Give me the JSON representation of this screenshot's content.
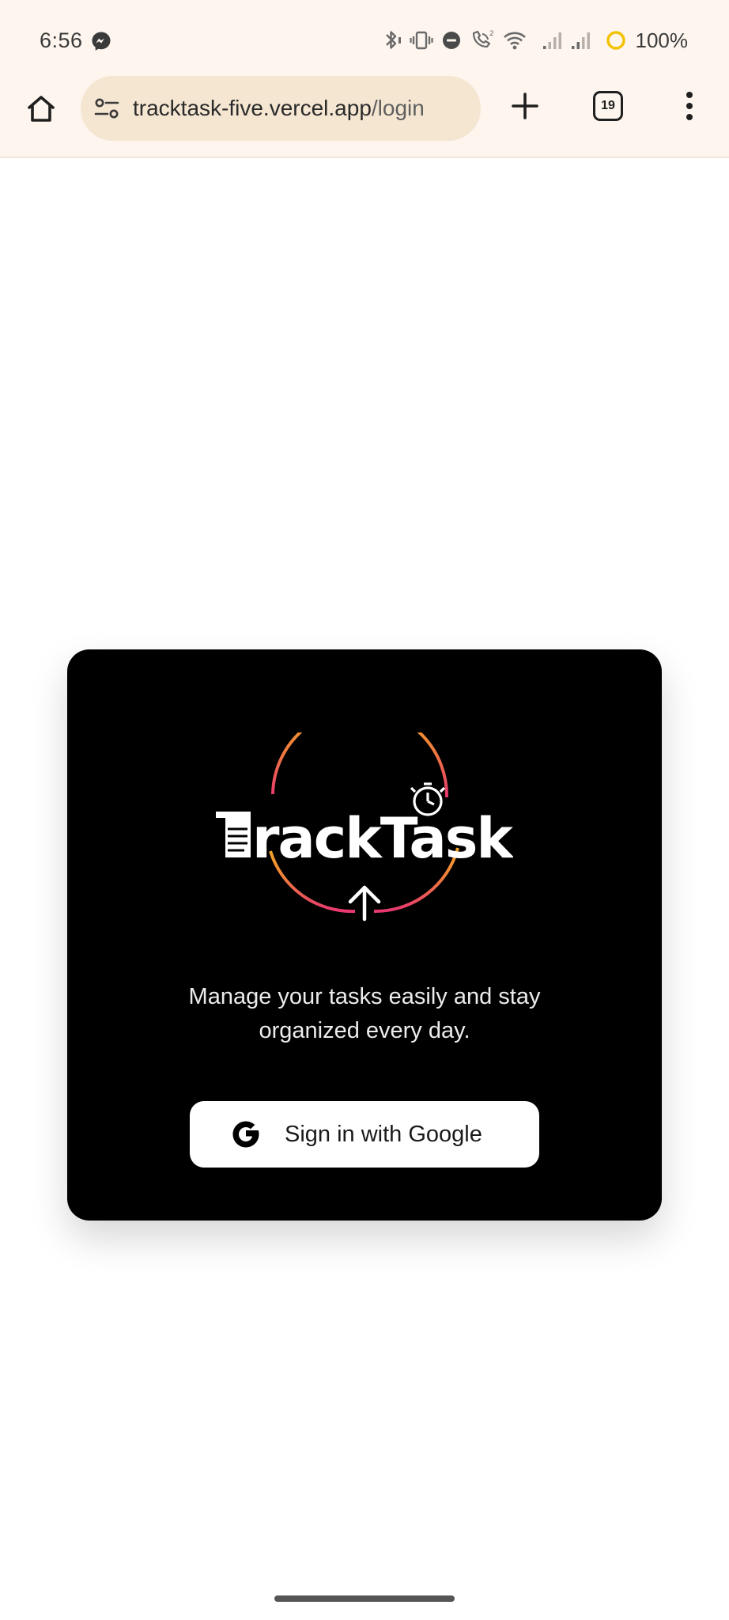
{
  "status_bar": {
    "time": "6:56",
    "battery_label": "100%",
    "icons": [
      "messenger-icon",
      "bluetooth-icon",
      "vibrate-icon",
      "do-not-disturb-icon",
      "wifi-calling-icon",
      "wifi-icon",
      "signal-icon",
      "signal-icon",
      "battery-saver-icon"
    ]
  },
  "browser": {
    "url_host": "tracktask-five.vercel.app",
    "url_path": "/login",
    "tab_count": "19",
    "icons": [
      "home-icon",
      "site-info-icon",
      "plus-icon",
      "more-vert-icon"
    ]
  },
  "login": {
    "logo_text": "TrackTask",
    "tagline": "Manage your tasks easily and stay organized every day.",
    "google_button_label": "Sign in with Google",
    "icons": [
      "google-icon"
    ]
  },
  "colors": {
    "chrome_background": "#fdf5ee",
    "url_pill": "#f5e6d2",
    "card_background": "#000000",
    "logo_ring_top": "#f2a52a",
    "logo_ring_bottom": "#e8386f",
    "button_background": "#ffffff"
  }
}
